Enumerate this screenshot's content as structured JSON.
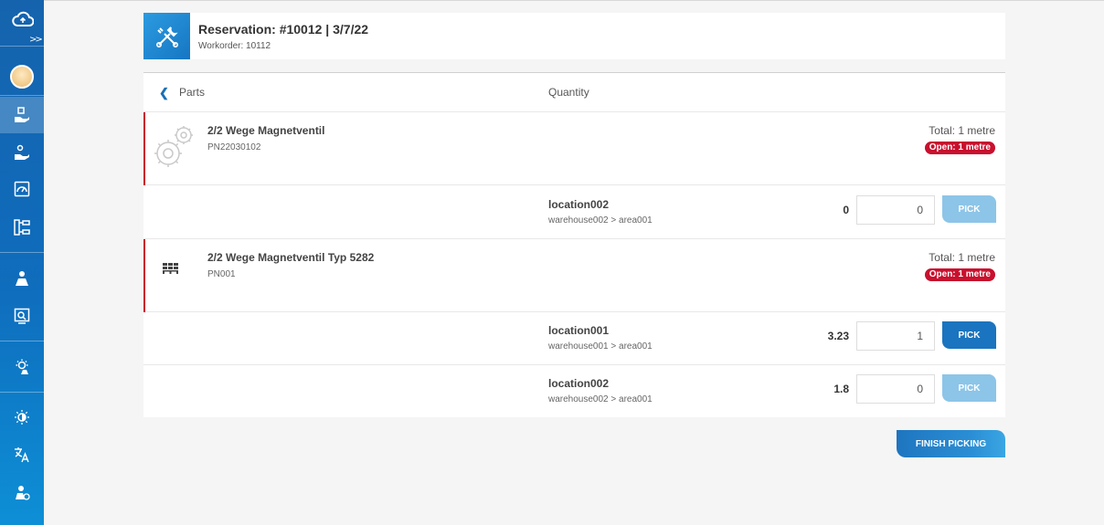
{
  "header": {
    "title": "Reservation: #10012 | 3/7/22",
    "subtitle": "Workorder: 10112"
  },
  "table": {
    "col_parts": "Parts",
    "col_quantity": "Quantity"
  },
  "parts": [
    {
      "name": "2/2 Wege Magnetventil",
      "pn": "PN22030102",
      "total": "Total: 1 metre",
      "open": "Open: 1 metre",
      "icon": "gears-icon",
      "locations": [
        {
          "name": "location002",
          "path": "warehouse002 > area001",
          "qty": "0",
          "input": "0",
          "pick": "PICK",
          "pick_enabled": false
        }
      ]
    },
    {
      "name": "2/2 Wege Magnetventil Typ 5282",
      "pn": "PN001",
      "total": "Total: 1 metre",
      "open": "Open: 1 metre",
      "icon": "pallet-icon",
      "locations": [
        {
          "name": "location001",
          "path": "warehouse001 > area001",
          "qty": "3.23",
          "input": "1",
          "pick": "PICK",
          "pick_enabled": true
        },
        {
          "name": "location002",
          "path": "warehouse002 > area001",
          "qty": "1.8",
          "input": "0",
          "pick": "PICK",
          "pick_enabled": false
        }
      ]
    }
  ],
  "finish_label": "FINISH PICKING",
  "colors": {
    "accent": "#1a74bf",
    "open_badge": "#c8102e",
    "pick_disabled": "#8cc5e8"
  }
}
